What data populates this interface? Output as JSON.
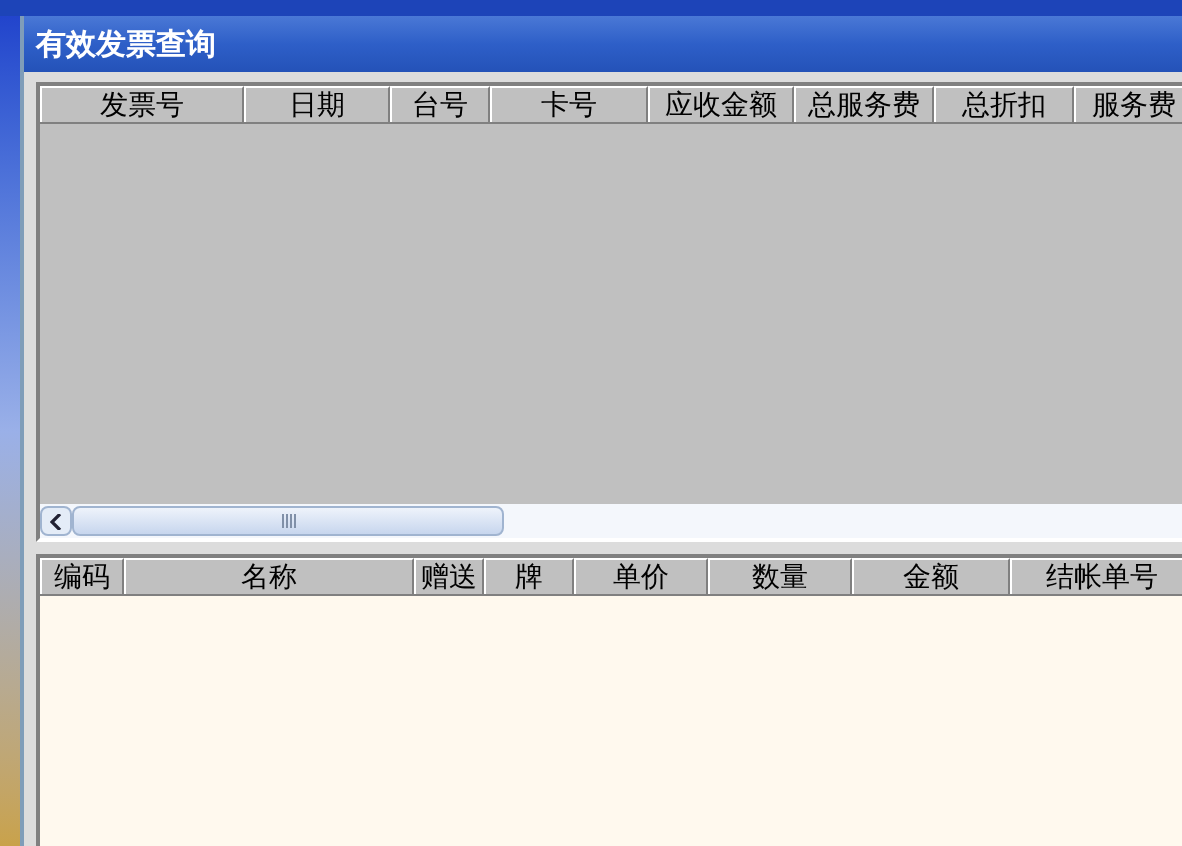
{
  "window": {
    "title": "有效发票查询"
  },
  "invoice_table": {
    "columns": [
      {
        "label": "发票号"
      },
      {
        "label": "日期"
      },
      {
        "label": "台号"
      },
      {
        "label": "卡号"
      },
      {
        "label": "应收金额"
      },
      {
        "label": "总服务费"
      },
      {
        "label": "总折扣"
      },
      {
        "label": "服务费"
      }
    ]
  },
  "detail_table": {
    "columns": [
      {
        "label": "编码"
      },
      {
        "label": "名称"
      },
      {
        "label": "赠送"
      },
      {
        "label": "牌"
      },
      {
        "label": "单价"
      },
      {
        "label": "数量"
      },
      {
        "label": "金额"
      },
      {
        "label": "结帐单号"
      }
    ]
  }
}
